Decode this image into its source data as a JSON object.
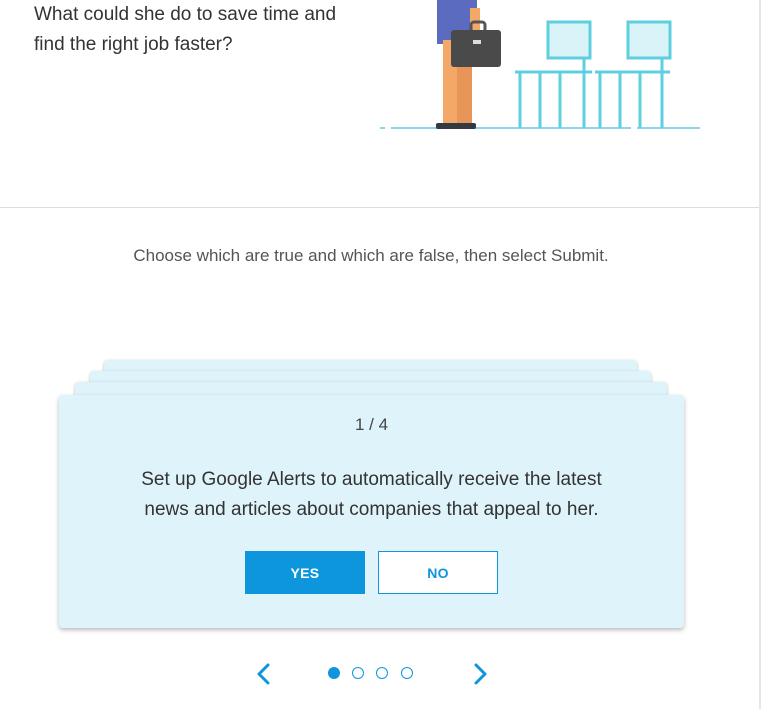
{
  "question": {
    "line1": "What could she do to save time and",
    "line2": "find the right job faster?"
  },
  "instruction": "Choose which are true and which are false, then select Submit.",
  "card": {
    "counter": "1 / 4",
    "statement_line1": "Set up Google Alerts to automatically receive the latest",
    "statement_line2": "news and articles about companies that appeal to her.",
    "yes_label": "YES",
    "no_label": "NO"
  },
  "navigation": {
    "current_page": 1,
    "total_pages": 4,
    "prev_icon": "chevron-left-icon",
    "next_icon": "chevron-right-icon"
  },
  "colors": {
    "accent": "#0e96dc",
    "card_background": "#dff3fb",
    "chair": "#5fcfe0",
    "briefcase": "#4a4a4a",
    "legs": "#f0a060"
  }
}
